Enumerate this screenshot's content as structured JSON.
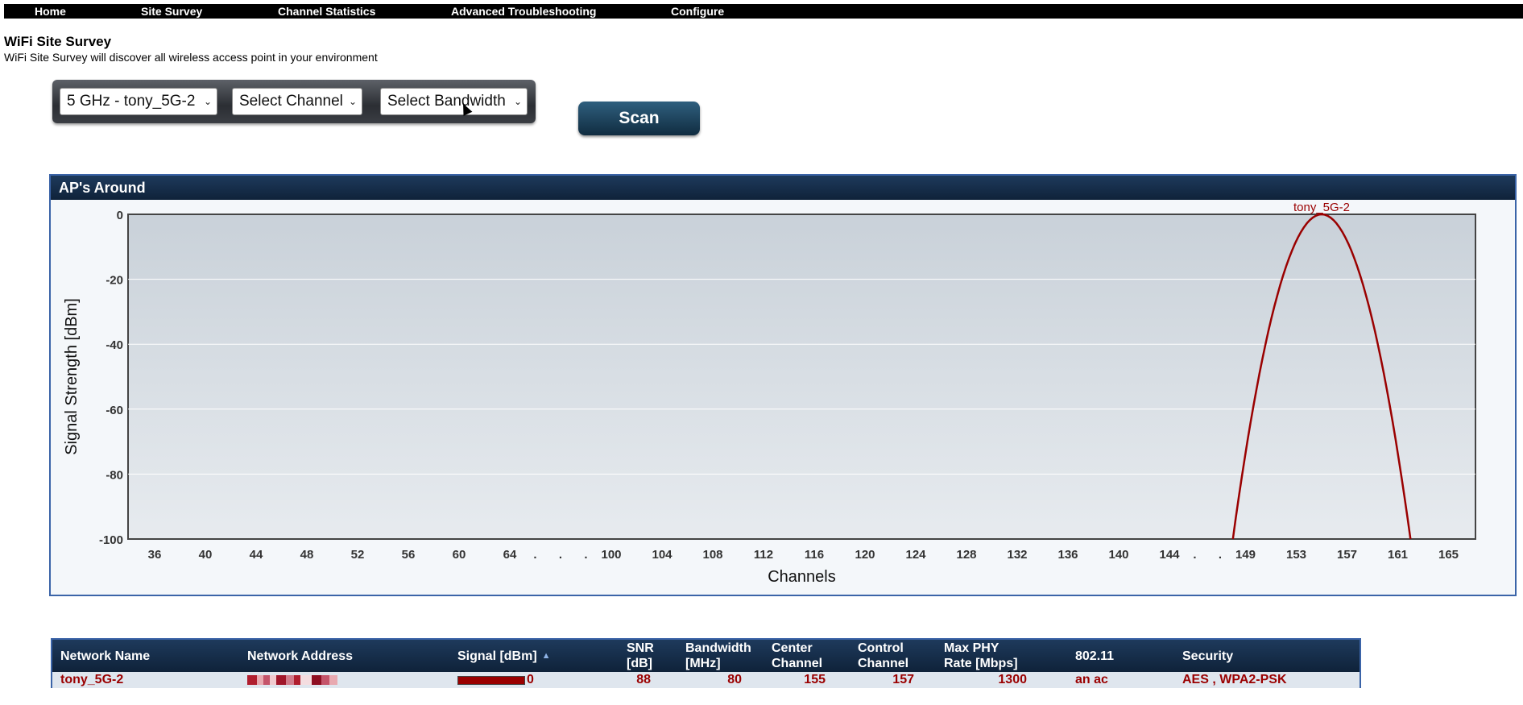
{
  "nav": {
    "items": [
      {
        "label": "Home"
      },
      {
        "label": "Site Survey"
      },
      {
        "label": "Channel Statistics"
      },
      {
        "label": "Advanced Troubleshooting"
      },
      {
        "label": "Configure"
      }
    ]
  },
  "page": {
    "title": "WiFi Site Survey",
    "subtitle": "WiFi Site Survey will discover all wireless access point in your environment"
  },
  "controls": {
    "band_select": "5 GHz - tony_5G-2",
    "channel_select": "Select Channel",
    "bandwidth_select": "Select Bandwidth",
    "scan_label": "Scan"
  },
  "chart": {
    "panel_title": "AP's Around",
    "line_color": "#9a0000"
  },
  "chart_data": {
    "type": "area",
    "xlabel": "Channels",
    "ylabel": "Signal Strength [dBm]",
    "ylim": [
      -100,
      0
    ],
    "yticks": [
      "0",
      "-20",
      "-40",
      "-60",
      "-80",
      "-100"
    ],
    "xticks": [
      "36",
      "40",
      "44",
      "48",
      "52",
      "56",
      "60",
      "64",
      ".",
      ".",
      ".",
      "100",
      "104",
      "108",
      "112",
      "116",
      "120",
      "124",
      "128",
      "132",
      "136",
      "140",
      "144",
      ".",
      ".",
      "149",
      "153",
      "157",
      "161",
      "165"
    ],
    "grid": true,
    "series": [
      {
        "name": "tony_5G-2",
        "center_channel": 155,
        "bandwidth_mhz": 80,
        "peak_dbm": 0,
        "floor_dbm": -100,
        "channel_span": [
          148,
          162
        ]
      }
    ]
  },
  "table": {
    "headers": [
      "Network Name",
      "Network Address",
      "Signal [dBm]",
      "SNR\n[dB]",
      "Bandwidth\n[MHz]",
      "Center\nChannel",
      "Control\nChannel",
      "Max PHY\nRate [Mbps]",
      "802.11",
      "Security"
    ],
    "rows": [
      {
        "network_name": "tony_5G-2",
        "signal": "0",
        "signal_fraction": 1.0,
        "snr": "88",
        "bandwidth": "80",
        "center_channel": "155",
        "control_channel": "157",
        "max_phy_rate": "1300",
        "standard": "an ac",
        "security": "AES , WPA2-PSK"
      }
    ]
  }
}
